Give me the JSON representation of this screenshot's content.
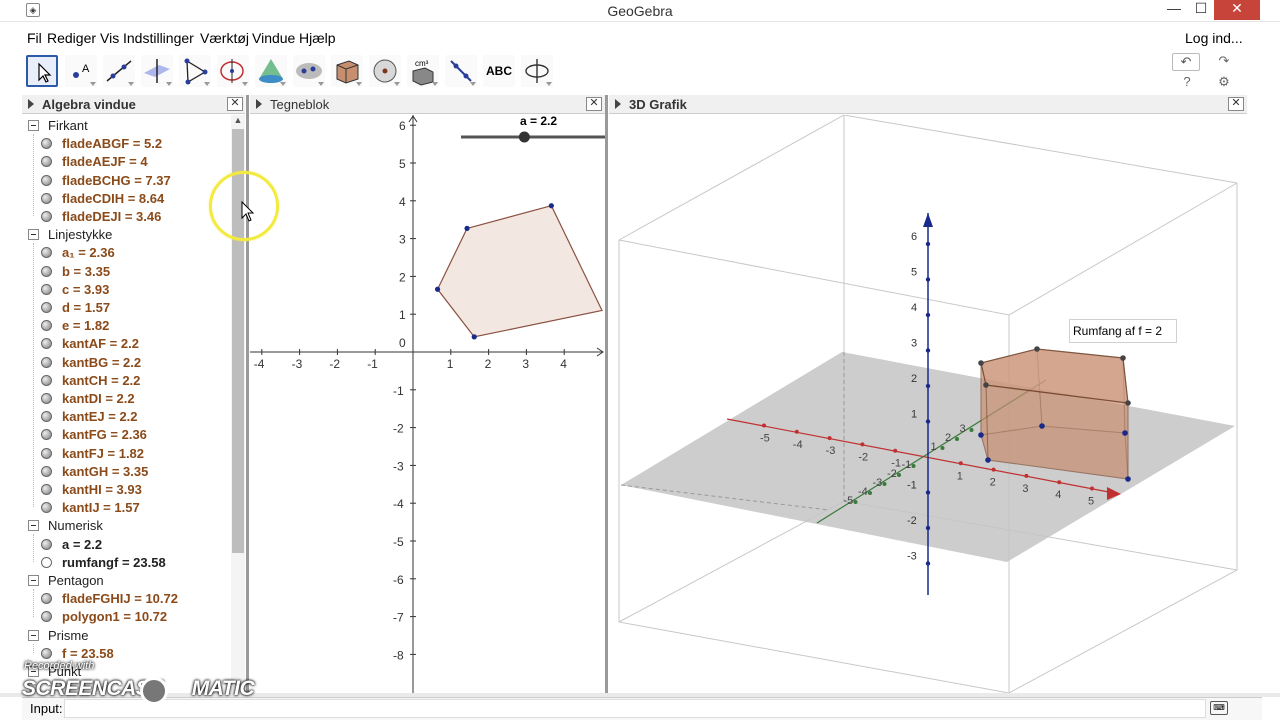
{
  "window": {
    "title": "GeoGebra",
    "app_icon": "geogebra-icon",
    "min": "—",
    "max": "☐",
    "close": "✕"
  },
  "menu": {
    "items": [
      "Fil",
      "Rediger",
      "Vis",
      "Indstillinger",
      "Værktøj",
      "Vindue",
      "Hjælp"
    ],
    "login": "Log ind..."
  },
  "toolbar": {
    "tools": [
      "move",
      "point",
      "line",
      "perpendicular",
      "polygon",
      "circle",
      "cone",
      "reflect",
      "prism",
      "sphere",
      "net",
      "transform",
      "ABC",
      "rotate-view"
    ],
    "abc_label": "ABC",
    "cm3_label": "cm³",
    "undo": "↶",
    "redo": "↷",
    "help": "?",
    "settings": "⚙"
  },
  "panels": {
    "algebra": "Algebra vindue",
    "graphics": "Tegneblok",
    "graphics3d": "3D Grafik",
    "close": "✕"
  },
  "algebra": {
    "categories": [
      {
        "name": "Firkant",
        "items": [
          {
            "text": "fladeABGF = 5.2"
          },
          {
            "text": "fladeAEJF = 4"
          },
          {
            "text": "fladeBCHG = 7.37"
          },
          {
            "text": "fladeCDIH = 8.64"
          },
          {
            "text": "fladeDEJI = 3.46"
          }
        ]
      },
      {
        "name": "Linjestykke",
        "items": [
          {
            "text": "a₁ = 2.36"
          },
          {
            "text": "b = 3.35"
          },
          {
            "text": "c = 3.93"
          },
          {
            "text": "d = 1.57"
          },
          {
            "text": "e = 1.82"
          },
          {
            "text": "kantAF = 2.2"
          },
          {
            "text": "kantBG = 2.2"
          },
          {
            "text": "kantCH = 2.2"
          },
          {
            "text": "kantDI = 2.2"
          },
          {
            "text": "kantEJ = 2.2"
          },
          {
            "text": "kantFG = 2.36"
          },
          {
            "text": "kantFJ = 1.82"
          },
          {
            "text": "kantGH = 3.35"
          },
          {
            "text": "kantHI = 3.93"
          },
          {
            "text": "kantIJ = 1.57"
          }
        ]
      },
      {
        "name": "Numerisk",
        "items": [
          {
            "text": "a = 2.2",
            "black": true
          },
          {
            "text": "rumfangf = 23.58",
            "black": true,
            "empty": true
          }
        ]
      },
      {
        "name": "Pentagon",
        "items": [
          {
            "text": "fladeFGHIJ = 10.72"
          },
          {
            "text": "polygon1 = 10.72"
          }
        ]
      },
      {
        "name": "Prisme",
        "items": [
          {
            "text": "f = 23.58"
          }
        ]
      },
      {
        "name": "Punkt",
        "items": []
      }
    ]
  },
  "graphics2d": {
    "slider_label": "a = 2.2",
    "slider_value": 2.2,
    "x_ticks": [
      "-4",
      "-3",
      "-2",
      "-1",
      "1",
      "2",
      "3",
      "4"
    ],
    "y_ticks": [
      "6",
      "5",
      "4",
      "3",
      "2",
      "1",
      "0",
      "-1",
      "-2",
      "-3",
      "-4",
      "-5",
      "-6",
      "-7",
      "-8"
    ]
  },
  "graphics3d": {
    "tooltip": "Rumfang af f = 2",
    "z_ticks": [
      "6",
      "5",
      "4",
      "3",
      "2",
      "1",
      "-1",
      "-2",
      "-3"
    ],
    "x_ticks": [
      "-5",
      "-4",
      "-3",
      "-2",
      "-1",
      "1",
      "2",
      "3",
      "4",
      "5"
    ],
    "y_ticks": [
      "-5",
      "-4",
      "-3",
      "-2",
      "-1",
      "1",
      "2",
      "3"
    ]
  },
  "input": {
    "label": "Input:",
    "value": ""
  },
  "watermark": {
    "recorded": "Recorded with",
    "brand_left": "SCREENCAST",
    "brand_right": "MATIC"
  }
}
